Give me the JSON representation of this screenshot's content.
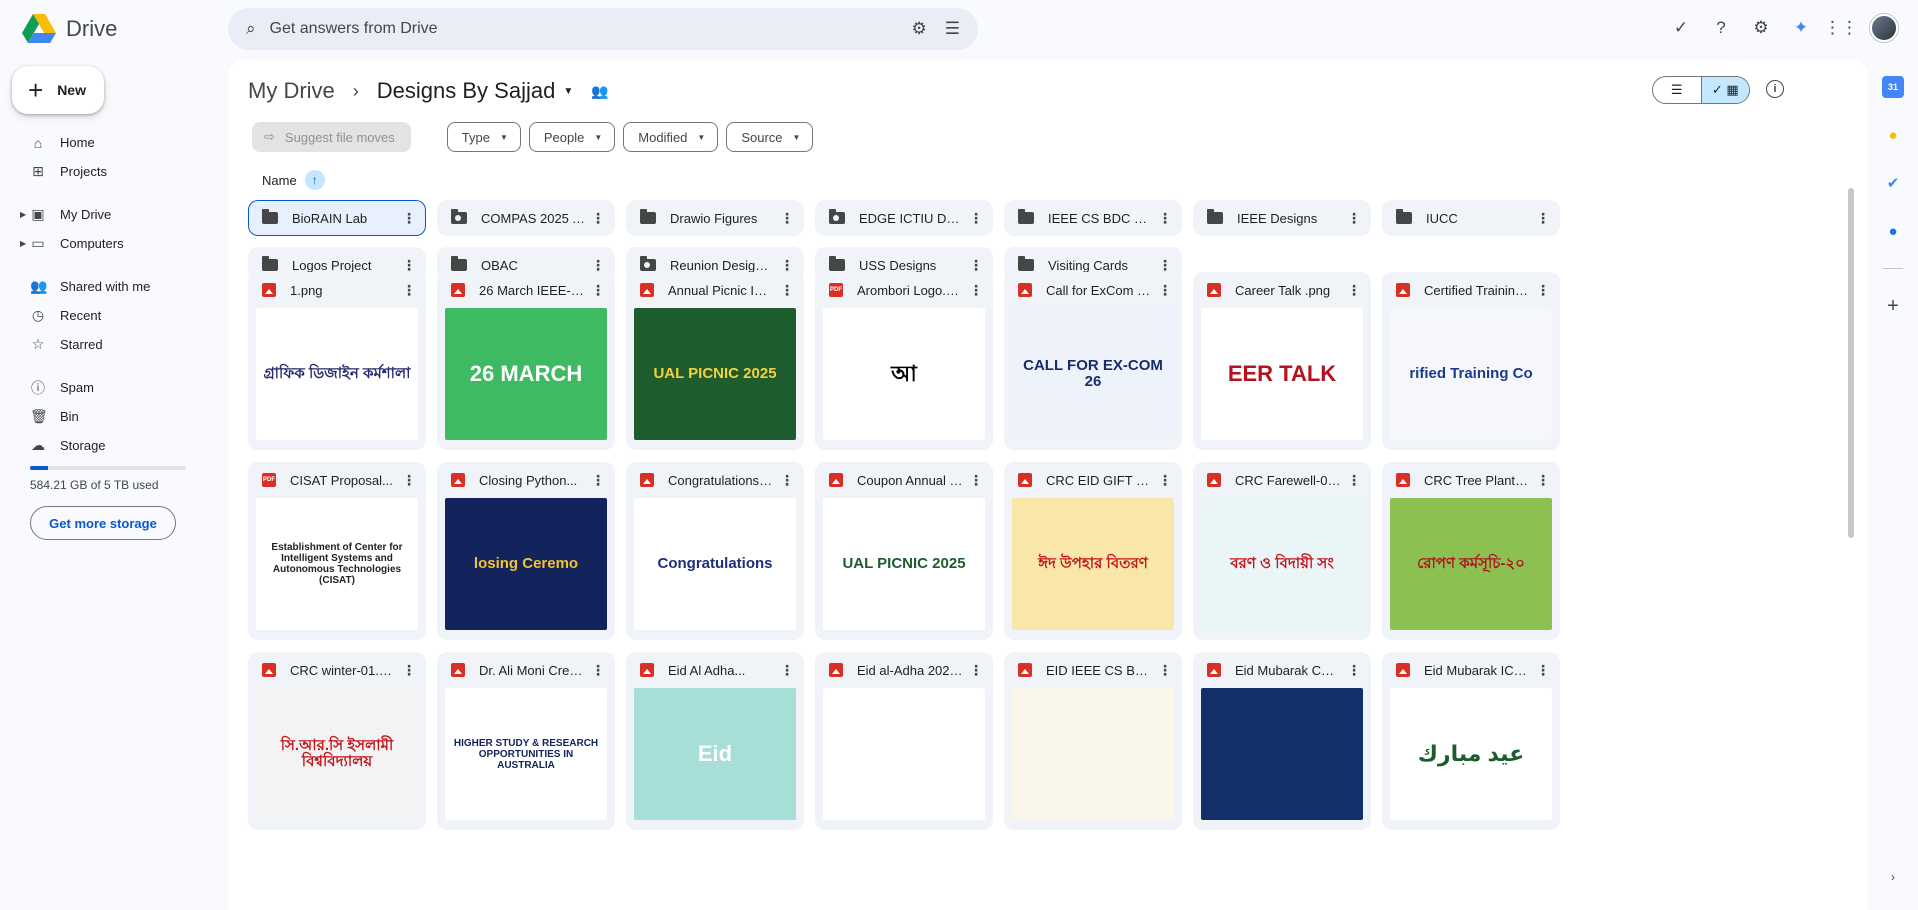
{
  "app": {
    "name": "Drive",
    "search_placeholder": "Get answers from Drive"
  },
  "topbar": {
    "icons": [
      "offline-status-icon",
      "help-icon",
      "settings-icon",
      "gemini-icon",
      "apps-grid-icon",
      "account-avatar"
    ]
  },
  "new_button": {
    "label": "New"
  },
  "nav": {
    "home": "Home",
    "projects": "Projects",
    "my_drive": "My Drive",
    "computers": "Computers",
    "shared": "Shared with me",
    "recent": "Recent",
    "starred": "Starred",
    "spam": "Spam",
    "bin": "Bin",
    "storage": "Storage"
  },
  "storage": {
    "used_text": "584.21 GB of 5 TB used",
    "used_fraction": 0.117,
    "button": "Get more storage"
  },
  "breadcrumb": {
    "root": "My Drive",
    "current": "Designs By Sajjad"
  },
  "filters": {
    "suggest": "Suggest file moves",
    "chips": [
      "Type",
      "People",
      "Modified",
      "Source"
    ]
  },
  "sort": {
    "label": "Name"
  },
  "folders": [
    {
      "name": "BioRAIN Lab",
      "shared": false
    },
    {
      "name": "COMPAS 2025 ALL...",
      "shared": true
    },
    {
      "name": "Drawio Figures",
      "shared": false
    },
    {
      "name": "EDGE ICTIU Designs",
      "shared": true
    },
    {
      "name": "IEEE CS BDC Summer...",
      "shared": false
    },
    {
      "name": "IEEE Designs",
      "shared": false
    },
    {
      "name": "IUCC",
      "shared": false
    },
    {
      "name": "Logos Project",
      "shared": false
    },
    {
      "name": "OBAC",
      "shared": false
    },
    {
      "name": "Reunion Design Files",
      "shared": true
    },
    {
      "name": "USS Designs",
      "shared": false
    },
    {
      "name": "Visiting Cards",
      "shared": false
    }
  ],
  "files": [
    {
      "name": "1.png",
      "type": "png",
      "thumb_text": "গ্রাফিক ডিজাইন কর্মশালা",
      "bg": "#ffffff",
      "fg": "#2a2a6e"
    },
    {
      "name": "26 March IEEE-01.png",
      "type": "png",
      "thumb_text": "26 MARCH",
      "bg": "#3dba62",
      "fg": "#ffffff"
    },
    {
      "name": "Annual Picnic ICT...",
      "type": "png",
      "thumb_text": "UAL PICNIC 2025",
      "bg": "#1e5c2e",
      "fg": "#f3d23a"
    },
    {
      "name": "Arombori Logo.pdf",
      "type": "pdf",
      "thumb_text": "আ",
      "bg": "#ffffff",
      "fg": "#000000"
    },
    {
      "name": "Call for ExCom 26.png",
      "type": "png",
      "thumb_text": "CALL FOR EX-COM 26",
      "bg": "#eef3fb",
      "fg": "#1b2c6b"
    },
    {
      "name": "Career Talk .png",
      "type": "png",
      "thumb_text": "EER TALK",
      "bg": "#ffffff",
      "fg": "#b3131e"
    },
    {
      "name": "Certified Training...",
      "type": "png",
      "thumb_text": "rified Training Co",
      "bg": "#f6f7fb",
      "fg": "#1e3a8a"
    },
    {
      "name": "CISAT Proposal...",
      "type": "pdf",
      "thumb_text": "Establishment of Center for Intelligent Systems and Autonomous Technologies (CISAT)",
      "bg": "#ffffff",
      "fg": "#222222"
    },
    {
      "name": "Closing Python...",
      "type": "png",
      "thumb_text": "losing Ceremo",
      "bg": "#13235c",
      "fg": "#f2c230"
    },
    {
      "name": "Congratulations ICT...",
      "type": "png",
      "thumb_text": "Congratulations",
      "bg": "#ffffff",
      "fg": "#1e2f7a"
    },
    {
      "name": "Coupon Annual Picnic...",
      "type": "png",
      "thumb_text": "UAL PICNIC 2025",
      "bg": "#ffffff",
      "fg": "#1e5c2e"
    },
    {
      "name": "CRC EID GIFT 2022...",
      "type": "png",
      "thumb_text": "ঈদ উপহার বিতরণ",
      "bg": "#f8e7a8",
      "fg": "#c4161c"
    },
    {
      "name": "CRC Farewell-01.png",
      "type": "png",
      "thumb_text": "বরণ ও বিদায়ী সং",
      "bg": "#eaf5f7",
      "fg": "#c4161c"
    },
    {
      "name": "CRC Tree Plantation...",
      "type": "png",
      "thumb_text": "রোপণ কর্মসূচি-২০",
      "bg": "#8cc152",
      "fg": "#b3131e"
    },
    {
      "name": "CRC winter-01.png",
      "type": "png",
      "thumb_text": "সি.আর.সি ইসলামী বিশ্ববিদ্যালয়",
      "bg": "#f3f3f3",
      "fg": "#c4161c"
    },
    {
      "name": "Dr. Ali Moni Crest...",
      "type": "png",
      "thumb_text": "HIGHER STUDY & RESEARCH OPPORTUNITIES IN AUSTRALIA",
      "bg": "#ffffff",
      "fg": "#13235c"
    },
    {
      "name": "Eid Al Adha...",
      "type": "png",
      "thumb_text": "Eid",
      "bg": "#a8ded8",
      "fg": "#ffffff"
    },
    {
      "name": "Eid al-Adha 2026...",
      "type": "png",
      "thumb_text": "",
      "bg": "#ffffff",
      "fg": "#0e6b3a"
    },
    {
      "name": "EID IEEE CS BDC.png",
      "type": "png",
      "thumb_text": "",
      "bg": "#fbf6ea",
      "fg": "#c49a2b"
    },
    {
      "name": "Eid Mubarak CEO...",
      "type": "png",
      "thumb_text": "",
      "bg": "#14306b",
      "fg": "#f2c230"
    },
    {
      "name": "Eid Mubarak ICT.png",
      "type": "png",
      "thumb_text": "عيد مبارك",
      "bg": "#ffffff",
      "fg": "#1e5c2e"
    }
  ],
  "rail": {
    "icons": [
      "calendar-icon",
      "keep-icon",
      "tasks-icon",
      "contacts-icon",
      "add-icon"
    ],
    "calendar_day": "31"
  }
}
